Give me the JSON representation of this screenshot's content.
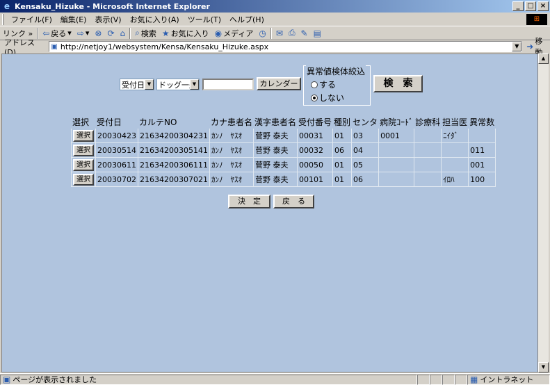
{
  "window": {
    "title": "Kensaku_Hizuke - Microsoft Internet Explorer"
  },
  "menu": [
    "ファイル(F)",
    "編集(E)",
    "表示(V)",
    "お気に入り(A)",
    "ツール(T)",
    "ヘルプ(H)"
  ],
  "toolbar": {
    "links": "リンク »",
    "back": "戻る",
    "search": "検索",
    "favorites": "お気に入り",
    "media": "メディア"
  },
  "address": {
    "label": "アドレス(D)",
    "url": "http://netjoy1/websystem/Kensa/Kensaku_Hizuke.aspx",
    "go": "移動"
  },
  "form": {
    "date_select": "受付日",
    "type_select": "ドッグ一般",
    "date_input": "",
    "calendar_button": "カレンダー",
    "filter_legend": "異常値検体絞込",
    "filter_options": [
      "する",
      "しない"
    ],
    "filter_selected": 1,
    "search_button": "検　索"
  },
  "table": {
    "headers": [
      "選択",
      "受付日",
      "カルテNO",
      "カナ患者名",
      "漢字患者名",
      "受付番号",
      "種別",
      "センタ",
      "病院ｺｰﾄﾞ",
      "診療科",
      "担当医",
      "異常数"
    ],
    "select_label": "選択",
    "rows": [
      [
        "20030423",
        "21634200304231",
        "ｶﾝﾉ　ﾔｽｵ",
        "菅野 泰夫",
        "00031",
        "01",
        "03",
        "0001",
        "",
        "ﾆｲﾀﾞ",
        ""
      ],
      [
        "20030514",
        "21634200305141",
        "ｶﾝﾉ　ﾔｽｵ",
        "菅野 泰夫",
        "00032",
        "06",
        "04",
        "",
        "",
        "",
        "011"
      ],
      [
        "20030611",
        "21634200306111",
        "ｶﾝﾉ　ﾔｽｵ",
        "菅野 泰夫",
        "00050",
        "01",
        "05",
        "",
        "",
        "",
        "001"
      ],
      [
        "20030702",
        "21634200307021",
        "ｶﾝﾉ　ﾔｽｵ",
        "菅野 泰夫",
        "00101",
        "01",
        "06",
        "",
        "",
        "ｲﾛﾊ",
        "100"
      ]
    ]
  },
  "actions": {
    "ok": "決　定",
    "back": "戻　る"
  },
  "status": {
    "message": "ページが表示されました",
    "zone": "イントラネット"
  }
}
